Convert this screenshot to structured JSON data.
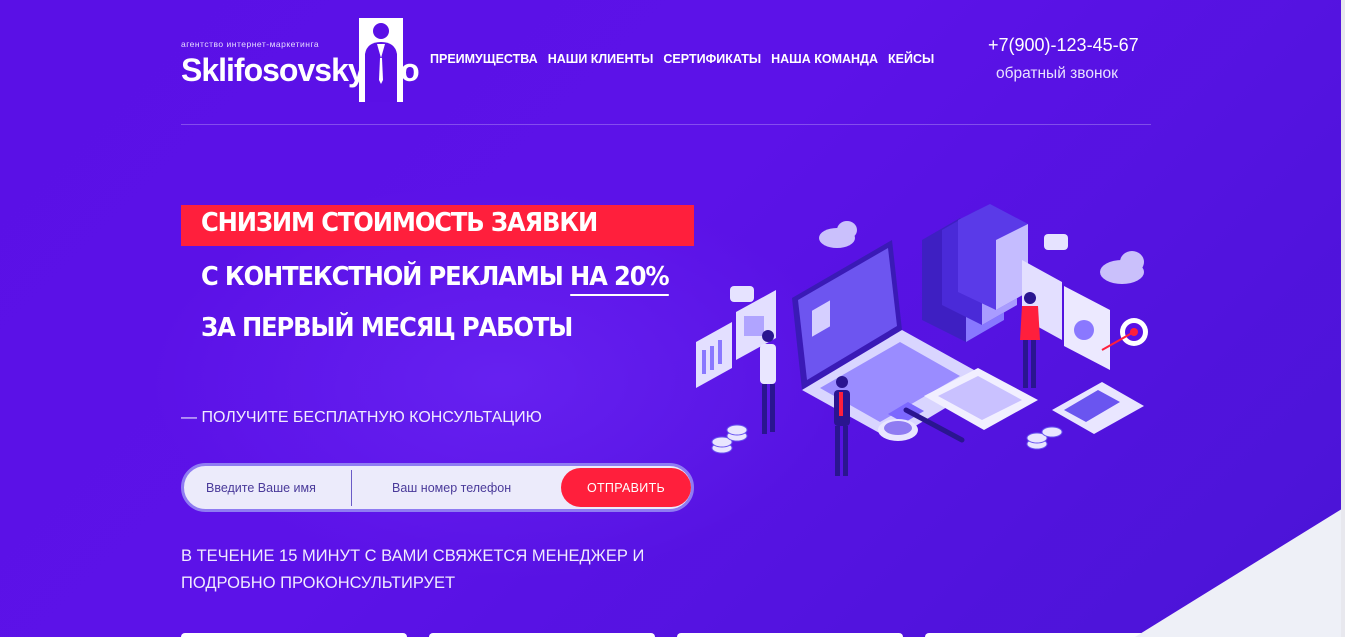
{
  "header": {
    "logo_tagline": "агентство интернет-маркетинга",
    "logo_name": "Sklifosovsky.pro",
    "nav": [
      {
        "label": "ПРЕИМУЩЕСТВА"
      },
      {
        "label": "НАШИ КЛИЕНТЫ"
      },
      {
        "label": "СЕРТИФИКАТЫ"
      },
      {
        "label": "НАША КОМАНДА"
      },
      {
        "label": "КЕЙСЫ"
      }
    ],
    "phone": "+7(900)-123-45-67",
    "callback": "обратный звонок"
  },
  "hero": {
    "line1": "СНИЗИМ СТОИМОСТЬ ЗАЯВКИ",
    "line2_a": "С КОНТЕКСТНОЙ РЕКЛАМЫ ",
    "line2_b": "НА 20%",
    "line3": "ЗА ПЕРВЫЙ МЕСЯЦ РАБОТЫ",
    "subtitle": "— ПОЛУЧИТЕ БЕСПЛАТНУЮ КОНСУЛЬТАЦИЮ",
    "note": "В ТЕЧЕНИЕ 15 МИНУТ С ВАМИ СВЯЖЕТСЯ МЕНЕДЖЕР И ПОДРОБНО ПРОКОНСУЛЬТИРУЕТ"
  },
  "form": {
    "name_placeholder": "Введите Ваше имя",
    "phone_placeholder": "Ваш номер телефон",
    "submit_label": "ОТПРАВИТЬ"
  },
  "colors": {
    "background": "#5a10e6",
    "accent": "#ff1f3c",
    "form_bg": "#ecebfb"
  }
}
